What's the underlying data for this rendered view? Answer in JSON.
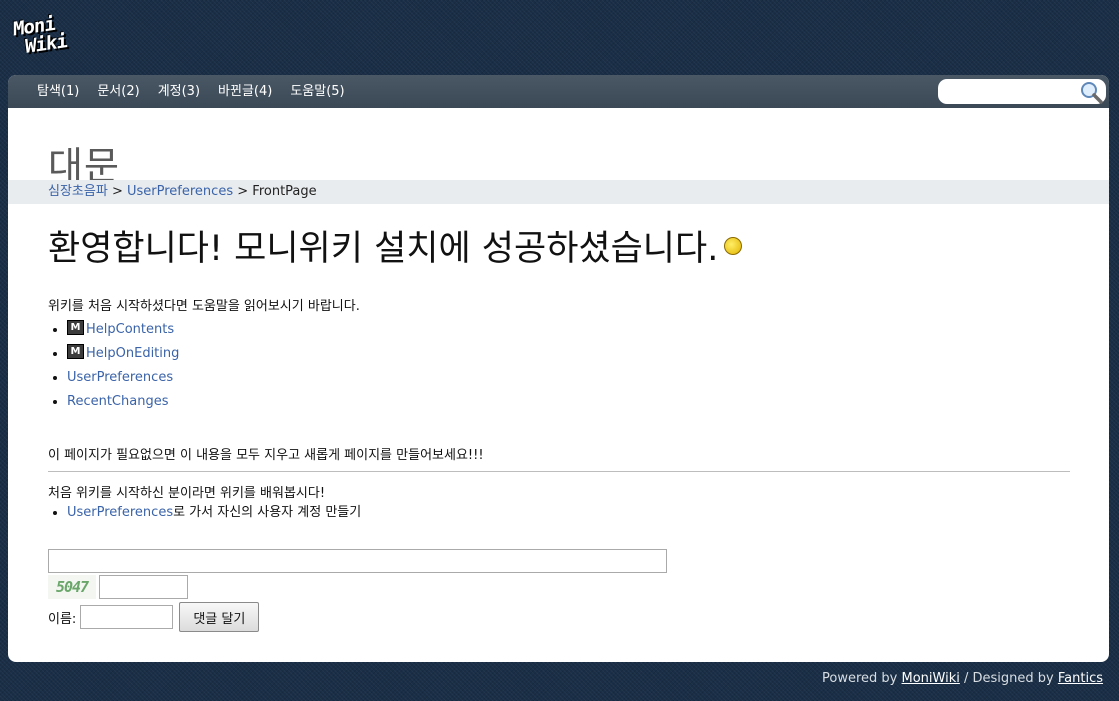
{
  "logo": {
    "line1": "Moni",
    "line2": "Wiki"
  },
  "nav": {
    "items": [
      "탐색(1)",
      "문서(2)",
      "계정(3)",
      "바뀐글(4)",
      "도움말(5)"
    ],
    "search_value": ""
  },
  "page": {
    "title": "대문",
    "breadcrumb": {
      "item1": "심장초음파",
      "sep": ">",
      "item2": "UserPreferences",
      "current": "FrontPage"
    }
  },
  "content": {
    "heading": "환영합니다! 모니위키 설치에 성공하셨습니다.",
    "intro": "위키를 처음 시작하셨다면 도움말을 읽어보시기 바랍니다.",
    "links": [
      "HelpContents",
      "HelpOnEditing",
      "UserPreferences",
      "RecentChanges"
    ],
    "message": "이 페이지가 필요없으면 이 내용을 모두 지우고 새롭게 페이지를 만들어보세요!!!",
    "learn": "처음 위키를 시작하신 분이라면 위키를 배워봅시다!",
    "learn_link": "UserPreferences",
    "learn_suffix": "로 가서 자신의 사용자 계정 만들기"
  },
  "comment": {
    "captcha": "5047",
    "name_label": "이름:",
    "submit_label": "댓글 달기"
  },
  "footer": {
    "powered": "Powered by",
    "moniwiki": "MoniWiki",
    "designed": "/ Designed by",
    "fantics": "Fantics"
  }
}
